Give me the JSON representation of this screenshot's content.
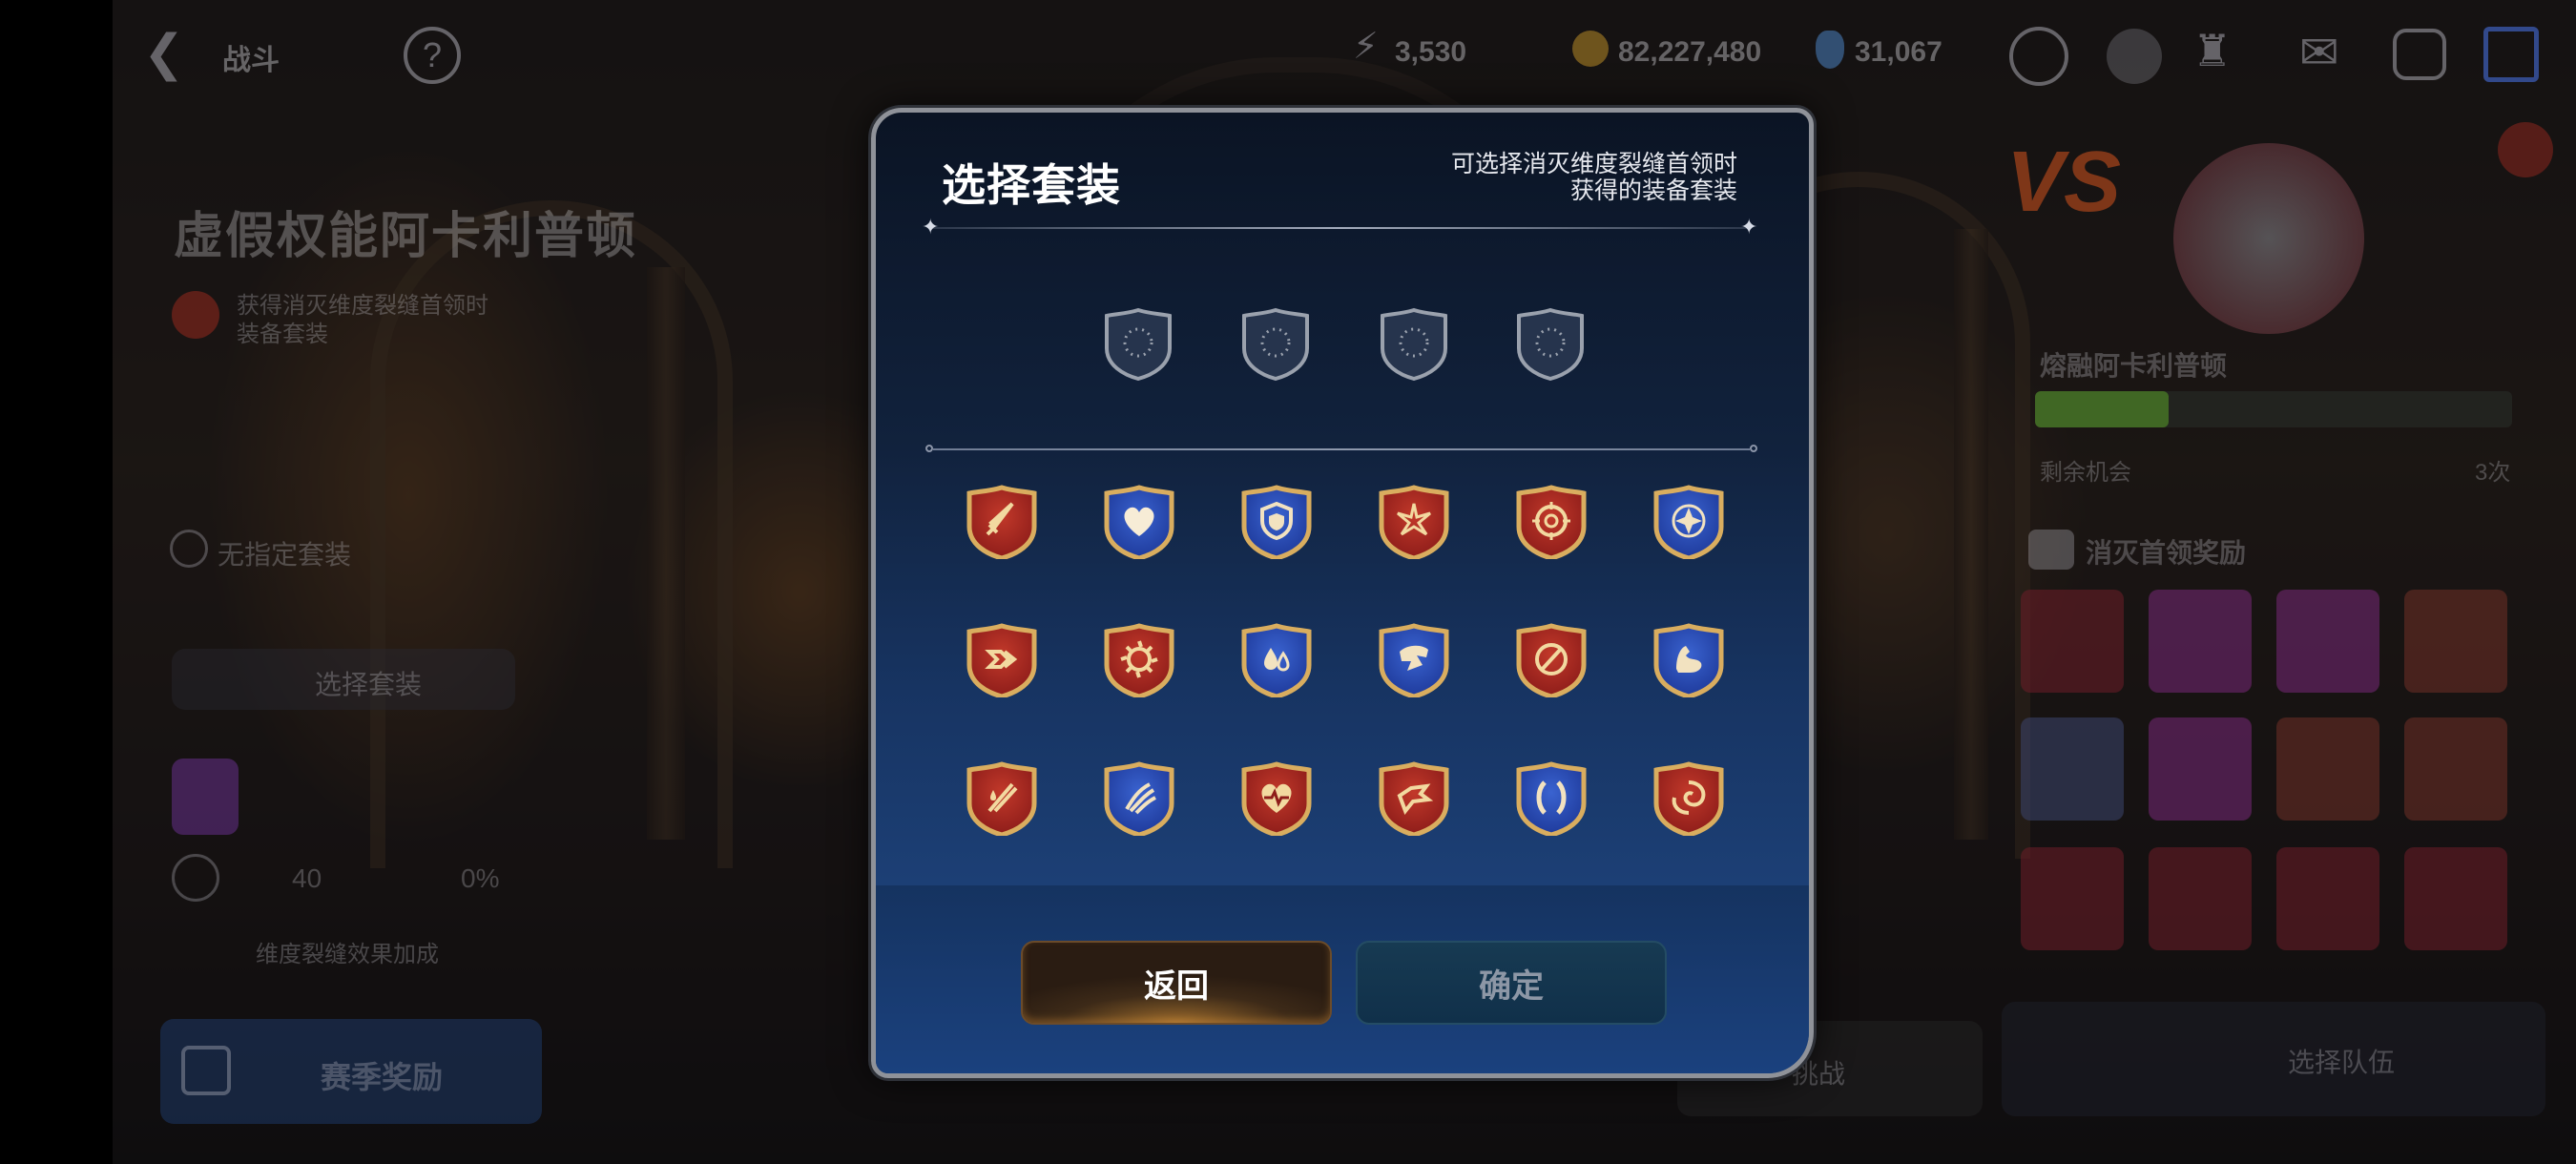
{
  "topbar": {
    "back_label": "战斗",
    "stamina": "3,530",
    "gold": "82,227,480",
    "crystal": "31,067"
  },
  "background": {
    "boss_title": "虚假权能阿卡利普顿",
    "boss_desc_line1": "获得消灭维度裂缝首领时",
    "boss_desc_line2": "装备套装",
    "no_set_label": "无指定套装",
    "select_set_label": "选择套装",
    "stat_a": "40",
    "stat_b": "0%",
    "rift_label": "维度裂缝效果加成",
    "season_reward_label": "赛季奖励",
    "right_boss_name": "熔融阿卡利普顿",
    "chance_label": "剩余机会",
    "chance_value": "3次",
    "reward_list_label": "消灭首领奖励",
    "bottom_right_label": "选择队伍",
    "bottom_center_label": "挑战"
  },
  "modal": {
    "title": "选择套装",
    "subtitle_line1": "可选择消灭维度裂缝首领时",
    "subtitle_line2": "获得的装备套装",
    "empty_slot_count": 4,
    "back_button": "返回",
    "confirm_button": "确定"
  },
  "set_icons": [
    {
      "name": "sword-set-icon",
      "style": "red",
      "glyph": "sword"
    },
    {
      "name": "heart-shield-set-icon",
      "style": "blue",
      "glyph": "heart"
    },
    {
      "name": "defense-set-icon",
      "style": "blue",
      "glyph": "shield"
    },
    {
      "name": "spike-set-icon",
      "style": "red",
      "glyph": "spike"
    },
    {
      "name": "target-set-icon",
      "style": "red",
      "glyph": "target"
    },
    {
      "name": "star-set-icon",
      "style": "blue",
      "glyph": "star"
    },
    {
      "name": "speed-set-icon",
      "style": "red",
      "glyph": "speed"
    },
    {
      "name": "sun-set-icon",
      "style": "red",
      "glyph": "sun"
    },
    {
      "name": "drops-set-icon",
      "style": "blue",
      "glyph": "drops"
    },
    {
      "name": "beast-set-icon",
      "style": "blue",
      "glyph": "beast"
    },
    {
      "name": "immunity-set-icon",
      "style": "red",
      "glyph": "slash"
    },
    {
      "name": "muscle-set-icon",
      "style": "blue",
      "glyph": "muscle"
    },
    {
      "name": "bleed-set-icon",
      "style": "red",
      "glyph": "bleed"
    },
    {
      "name": "claw-set-icon",
      "style": "blue",
      "glyph": "claw"
    },
    {
      "name": "life-set-icon",
      "style": "red",
      "glyph": "life"
    },
    {
      "name": "counter-set-icon",
      "style": "red",
      "glyph": "counter"
    },
    {
      "name": "barrier-set-icon",
      "style": "blue",
      "glyph": "barrier"
    },
    {
      "name": "vortex-set-icon",
      "style": "red",
      "glyph": "vortex"
    }
  ],
  "colors": {
    "red_badge": "#8e1d1a",
    "blue_badge": "#1f3b9c",
    "gold_rim": "#d9ad5f",
    "modal_border": "#8f9299"
  }
}
